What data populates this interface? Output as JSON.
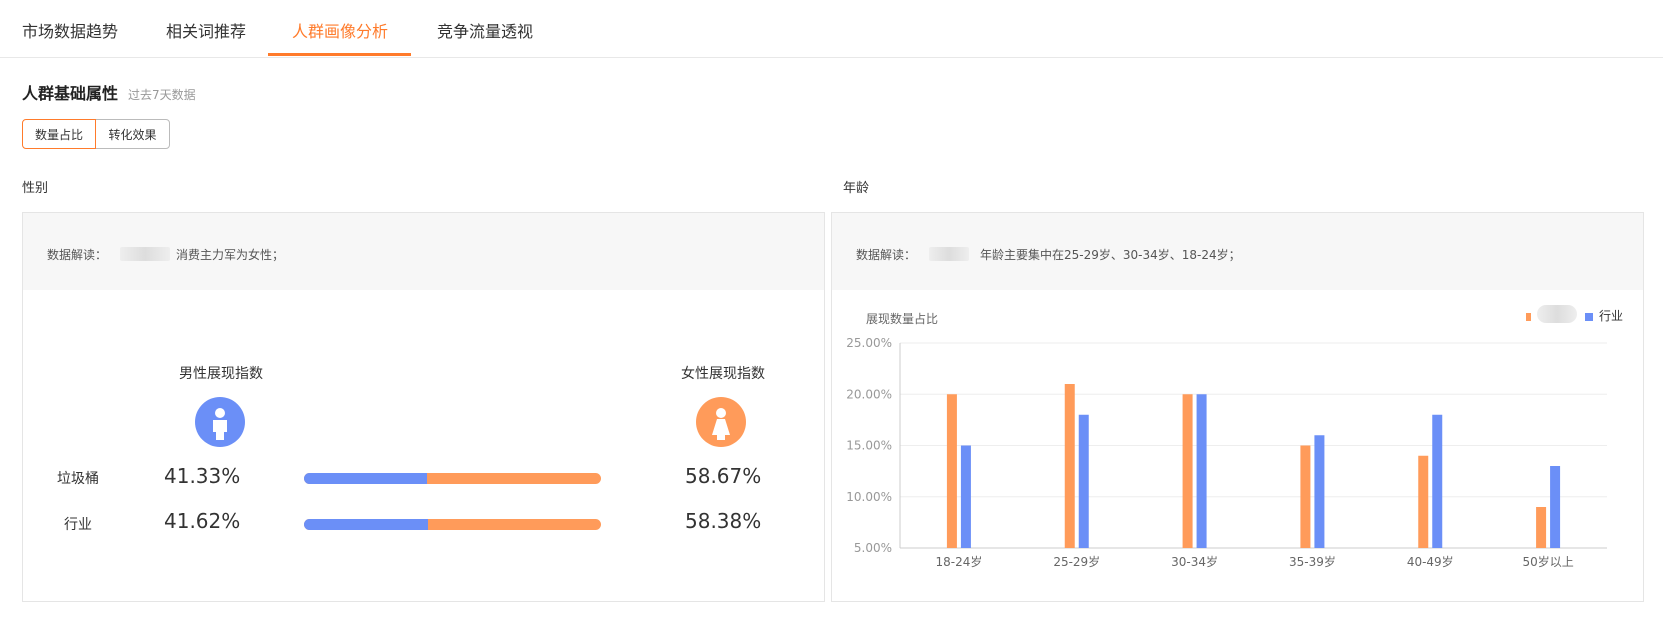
{
  "tabs": [
    {
      "label": "市场数据趋势",
      "active": false
    },
    {
      "label": "相关词推荐",
      "active": false
    },
    {
      "label": "人群画像分析",
      "active": true
    },
    {
      "label": "竞争流量透视",
      "active": false
    }
  ],
  "section": {
    "title": "人群基础属性",
    "subtitle": "过去7天数据"
  },
  "toggle": {
    "options": [
      "数量占比",
      "转化效果"
    ],
    "selected": "数量占比"
  },
  "gender": {
    "label": "性别",
    "note_label": "数据解读：",
    "note_text": "消费主力军为女性；",
    "male_heading": "男性展现指数",
    "female_heading": "女性展现指数",
    "rows": [
      {
        "name": "垃圾桶",
        "male": "41.33%",
        "female": "58.67%",
        "male_ratio": 0.4133
      },
      {
        "name": "行业",
        "male": "41.62%",
        "female": "58.38%",
        "male_ratio": 0.4162
      }
    ],
    "colors": {
      "male": "#6b8ff7",
      "female": "#ff9b5a"
    }
  },
  "age": {
    "label": "年龄",
    "note_label": "数据解读：",
    "note_text": "年龄主要集中在25-29岁、30-34岁、18-24岁；",
    "legend_industry": "行业",
    "colors": {
      "self": "#ff9b5a",
      "industry": "#6b8ff7"
    }
  },
  "chart_data": {
    "type": "bar",
    "ylabel": "展现数量占比",
    "categories": [
      "18-24岁",
      "25-29岁",
      "30-34岁",
      "35-39岁",
      "40-49岁",
      "50岁以上"
    ],
    "series": [
      {
        "values": [
          20,
          21,
          20,
          15,
          14,
          9
        ]
      },
      {
        "name": "行业",
        "values": [
          15,
          18,
          20,
          16,
          18,
          13
        ]
      }
    ],
    "yticks": [
      "5.00%",
      "10.00%",
      "15.00%",
      "20.00%",
      "25.00%"
    ],
    "ylim": [
      5,
      25
    ],
    "grid": true,
    "legend": "top-right"
  }
}
